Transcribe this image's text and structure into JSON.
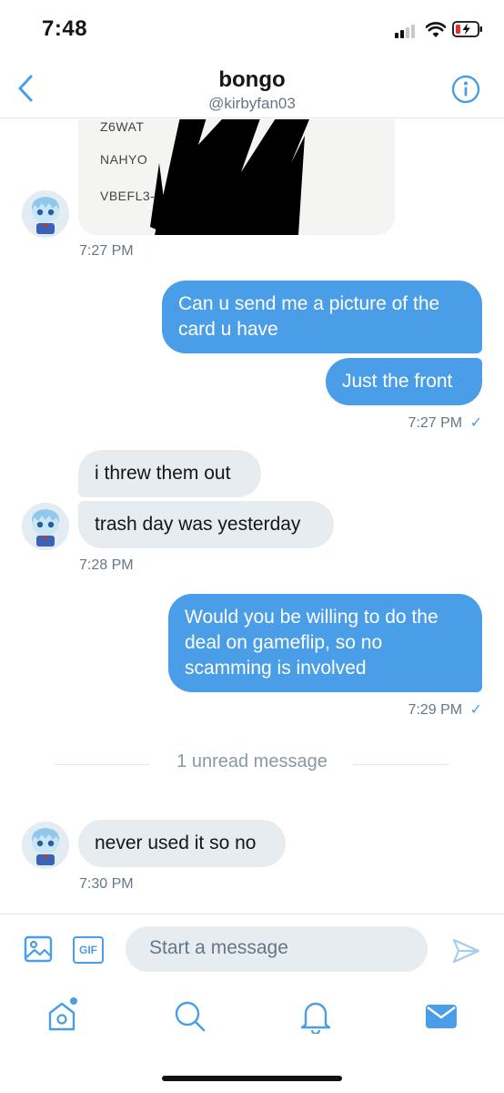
{
  "status_bar": {
    "time": "7:48"
  },
  "header": {
    "title": "bongo",
    "handle": "@kirbyfan03"
  },
  "image_message": {
    "codes": [
      "Z6WAT",
      "NAHYO",
      "VBEFL3-"
    ],
    "timestamp": "7:27 PM"
  },
  "messages": [
    {
      "id": "m1",
      "text": "Can u send me a picture of the card u have",
      "line1": "Can u send me a picture of the",
      "line2": "card u have"
    },
    {
      "id": "m2",
      "text": "Just the front"
    },
    {
      "id": "m3",
      "text": "i threw them out"
    },
    {
      "id": "m4",
      "text": "trash day was yesterday"
    },
    {
      "id": "m5",
      "line1": "Would you be willing to do the",
      "line2": "deal on gameflip, so no",
      "line3": "scamming is involved"
    },
    {
      "id": "m6",
      "text": "never used it so no"
    }
  ],
  "timestamps": {
    "t1": "7:27 PM",
    "t2": "7:28 PM",
    "t3": "7:29 PM",
    "t4": "7:30 PM"
  },
  "read_check": "✓",
  "unread_label": "1 unread message",
  "composer": {
    "placeholder": "Start a message",
    "gif_label": "GIF"
  },
  "colors": {
    "accent": "#4a9ee8",
    "incoming_bubble": "#e6ecf0",
    "text_secondary": "#657786"
  },
  "icons": [
    "back-chevron-icon",
    "info-icon",
    "image-icon",
    "gif-icon",
    "send-icon",
    "home-icon",
    "search-icon",
    "notifications-icon",
    "messages-icon"
  ]
}
